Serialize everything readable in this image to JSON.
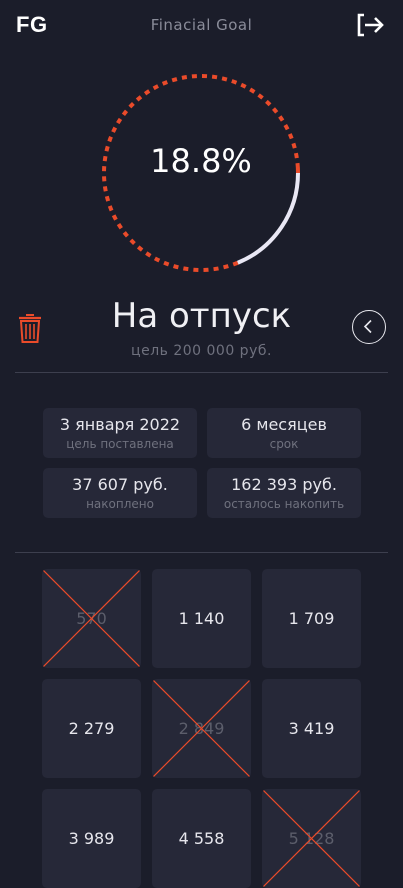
{
  "header": {
    "logo": "FG",
    "title": "Finacial Goal",
    "logout_icon": "logout-icon"
  },
  "progress": {
    "label": "18.8%",
    "fraction": 0.188,
    "dash_color": "#ea4b2a",
    "filled_color": "#e9e7f4"
  },
  "goal": {
    "name": "На отпуск",
    "target": "цель 200 000 руб."
  },
  "info": [
    {
      "value": "3 января 2022",
      "label": "цель поставлена"
    },
    {
      "value": "6 месяцев",
      "label": "срок"
    },
    {
      "value": "37 607 руб.",
      "label": "накоплено"
    },
    {
      "value": "162 393 руб.",
      "label": "осталось накопить"
    }
  ],
  "tiles": [
    {
      "value": "570",
      "done": true
    },
    {
      "value": "1 140",
      "done": false
    },
    {
      "value": "1 709",
      "done": false
    },
    {
      "value": "2 279",
      "done": false
    },
    {
      "value": "2 849",
      "done": true
    },
    {
      "value": "3 419",
      "done": false
    },
    {
      "value": "3 989",
      "done": false
    },
    {
      "value": "4 558",
      "done": false
    },
    {
      "value": "5 128",
      "done": true
    }
  ],
  "colors": {
    "background": "#1b1d2a",
    "card": "#262838",
    "accent": "#ea4b2a"
  }
}
